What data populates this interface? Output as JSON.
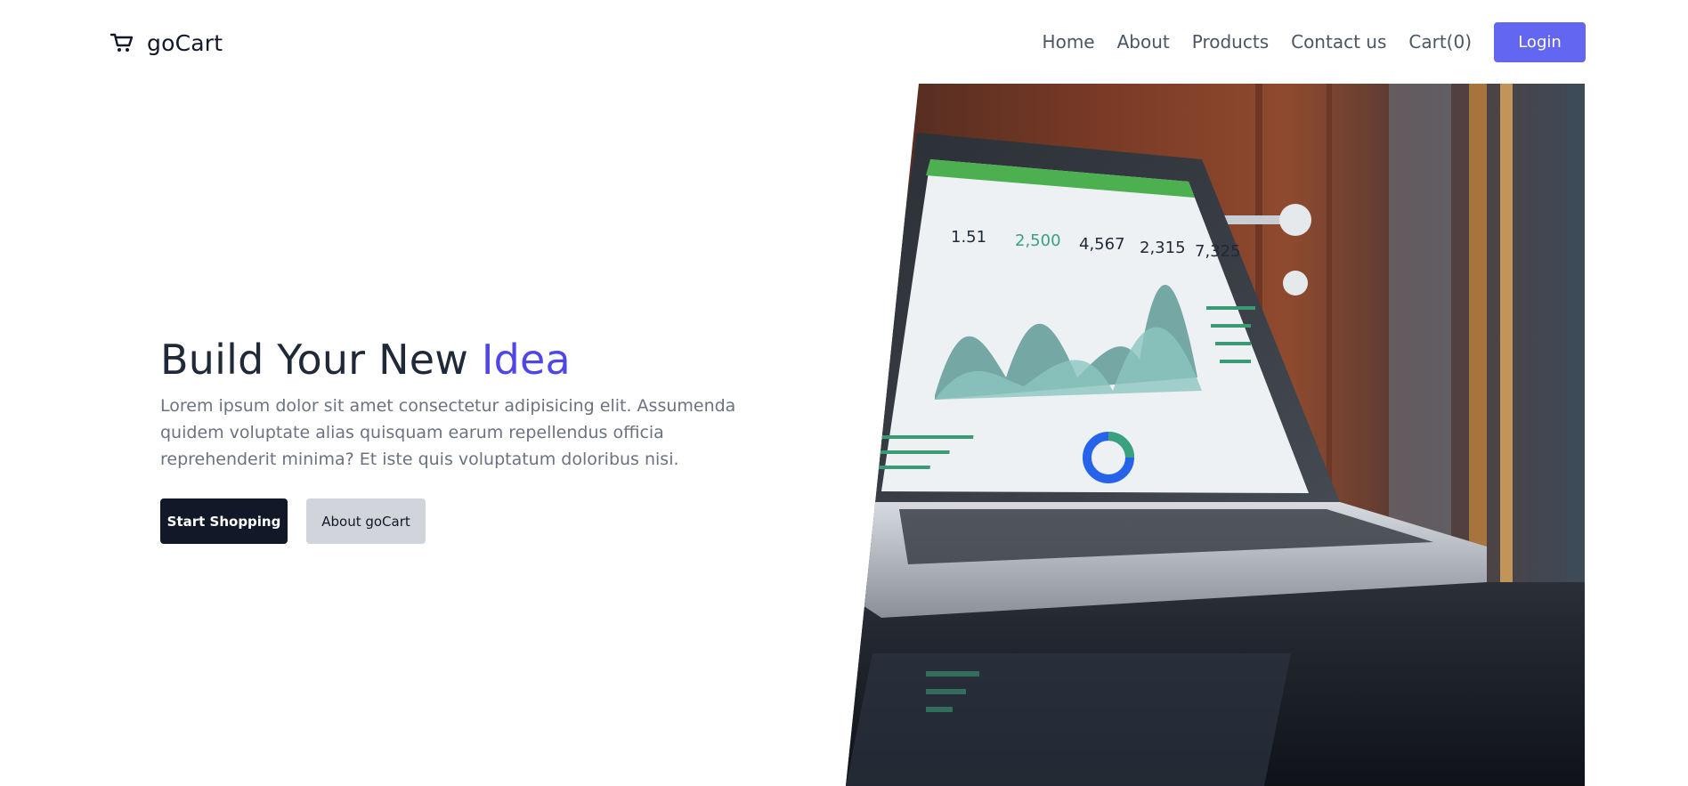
{
  "brand": {
    "name": "goCart",
    "icon": "shopping-cart-icon"
  },
  "nav": {
    "links": [
      "Home",
      "About",
      "Products",
      "Contact us",
      "Cart(0)"
    ],
    "login_label": "Login"
  },
  "hero": {
    "title_main": "Build Your New",
    "title_accent": "Idea",
    "description": "Lorem ipsum dolor sit amet consectetur adipisicing elit. Assumenda quidem voluptate alias quisquam earum repellendus officia reprehenderit minima? Et iste quis voluptatum doloribus nisi.",
    "primary_button": "Start Shopping",
    "secondary_button": "About goCart"
  },
  "colors": {
    "accent": "#6366f1",
    "accent_text": "#4f46e5",
    "primary_button": "#111827",
    "secondary_button": "#d1d5db"
  }
}
